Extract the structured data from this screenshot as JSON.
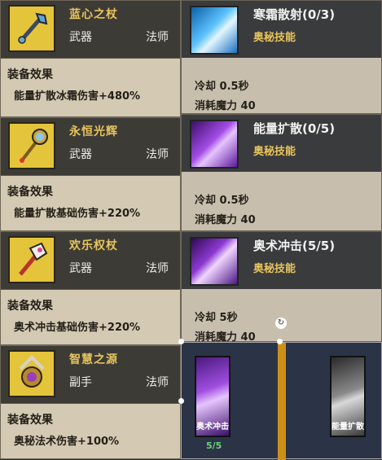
{
  "colors": {
    "gold": "#e8c45d",
    "card_bg": "#d4c9b3",
    "header_bg": "#3c3b36",
    "thumb_bg": "#e4c43b"
  },
  "equipment": [
    {
      "name": "蓝心之杖",
      "type": "武器",
      "class": "法师",
      "effect_title": "装备效果",
      "effect": "能量扩散冰霜伤害+480%",
      "icon": "blue-staff-icon"
    },
    {
      "name": "永恒光辉",
      "type": "武器",
      "class": "法师",
      "effect_title": "装备效果",
      "effect": "能量扩散基础伤害+220%",
      "icon": "radiant-scepter-icon"
    },
    {
      "name": "欢乐权杖",
      "type": "武器",
      "class": "法师",
      "effect_title": "装备效果",
      "effect": "奥术冲击基础伤害+220%",
      "icon": "joy-scepter-icon"
    },
    {
      "name": "智慧之源",
      "type": "副手",
      "class": "法师",
      "effect_title": "装备效果",
      "effect": "奥秘法术伤害+100%",
      "icon": "wisdom-orb-icon"
    }
  ],
  "skills": [
    {
      "name": "寒霜散射(0/3)",
      "type": "奥秘技能",
      "cooldown": "冷却  0.5秒",
      "cost": "消耗魔力  40",
      "icon": "frost-scatter-icon"
    },
    {
      "name": "能量扩散(0/5)",
      "type": "奥秘技能",
      "cooldown": "冷却  0.5秒",
      "cost": "消耗魔力  40",
      "icon": "energy-spread-icon"
    },
    {
      "name": "奥术冲击(5/5)",
      "type": "奥秘技能",
      "cooldown": "冷却  5秒",
      "cost": "消耗魔力  40",
      "icon": "arcane-strike-icon"
    }
  ],
  "skill_bar": {
    "slot1_label": "奥术冲击",
    "slot1_count": "5/5",
    "slot2_label": "能量扩散"
  }
}
